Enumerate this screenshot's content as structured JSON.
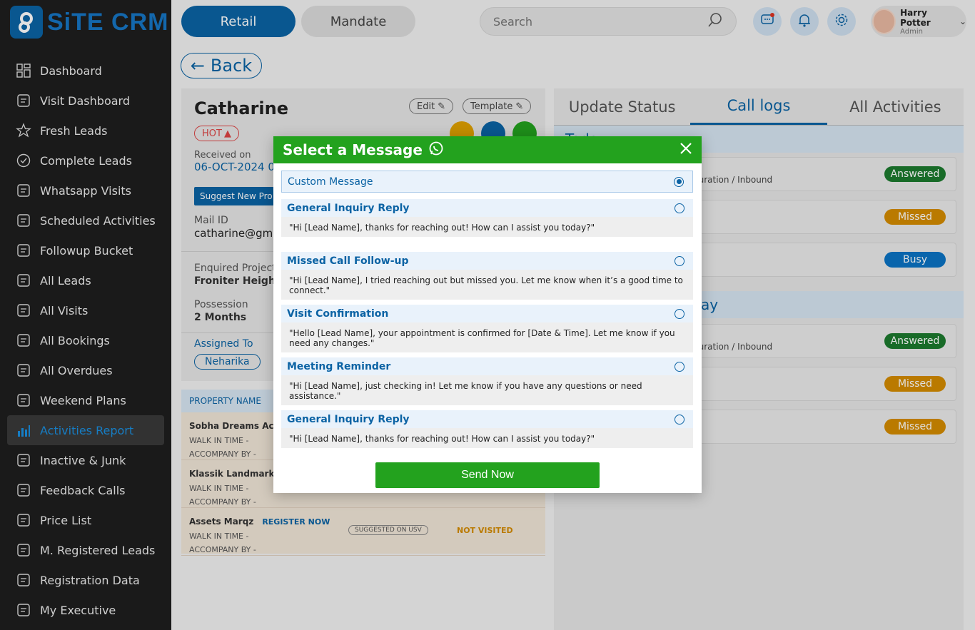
{
  "app": {
    "logo_text": "SiTE CRM"
  },
  "sidebar": {
    "items": [
      {
        "label": "Dashboard",
        "icon": "dashboard-icon"
      },
      {
        "label": "Visit Dashboard",
        "icon": "location-pin-icon"
      },
      {
        "label": "Fresh Leads",
        "icon": "star-icon"
      },
      {
        "label": "Complete Leads",
        "icon": "check-circle-icon"
      },
      {
        "label": "Whatsapp Visits",
        "icon": "whatsapp-icon"
      },
      {
        "label": "Scheduled Activities",
        "icon": "calendar-clock-icon"
      },
      {
        "label": "Followup Bucket",
        "icon": "user-bucket-icon"
      },
      {
        "label": "All Leads",
        "icon": "users-icon"
      },
      {
        "label": "All Visits",
        "icon": "building-icon"
      },
      {
        "label": "All Bookings",
        "icon": "document-icon"
      },
      {
        "label": "All Overdues",
        "icon": "overdue-clock-icon"
      },
      {
        "label": "Weekend Plans",
        "icon": "checklist-icon"
      },
      {
        "label": "Activities Report",
        "icon": "bar-chart-icon"
      },
      {
        "label": "Inactive & Junk",
        "icon": "moon-icon"
      },
      {
        "label": "Feedback Calls",
        "icon": "phone-feedback-icon"
      },
      {
        "label": "Price List",
        "icon": "price-list-icon"
      },
      {
        "label": "M. Registered Leads",
        "icon": "registered-icon"
      },
      {
        "label": "Registration Data",
        "icon": "edit-document-icon"
      },
      {
        "label": "My Executive",
        "icon": "team-icon"
      }
    ],
    "active_index": 12
  },
  "topbar": {
    "retail_label": "Retail",
    "mandate_label": "Mandate",
    "search_placeholder": "Search",
    "user_name": "Harry Potter",
    "user_role": "Admin"
  },
  "back_label": "Back",
  "lead": {
    "name": "Catharine",
    "hot_label": "HOT",
    "edit_label": "Edit",
    "template_label": "Template",
    "received_label": "Received on",
    "received_value": "06-OCT-2024 0",
    "suggest_label": "Suggest New Pro",
    "mail_label": "Mail ID",
    "mail_value": "catharine@gm",
    "project_label": "Enquired Project",
    "project_value": "Froniter Heights",
    "possession_label": "Possession",
    "possession_value": "2 Months",
    "assigned_label": "Assigned To",
    "assigned_value": "Neharika"
  },
  "properties": {
    "header": "PROPERTY NAME",
    "rows": [
      {
        "name": "Sobha Dreams Acre",
        "register": "",
        "walk": "WALK IN TIME -",
        "accompany": "ACCOMPANY BY -",
        "suggested": "",
        "status": ""
      },
      {
        "name": "Klassik Landmark",
        "register": "R",
        "walk": "WALK IN TIME -",
        "accompany": "ACCOMPANY BY -",
        "suggested": "",
        "status": ""
      },
      {
        "name": "Assets Marqz",
        "register": "REGISTER NOW",
        "walk": "WALK IN TIME -",
        "accompany": "ACCOMPANY BY -",
        "suggested": "SUGGESTED ON USV",
        "status": "NOT VISITED"
      }
    ]
  },
  "right_panel": {
    "tabs": [
      "Update Status",
      "Call logs",
      "All Activities"
    ],
    "active_tab": 1,
    "today_label": "Today",
    "yesterday_label": "ay",
    "today_logs": [
      {
        "sub": "duration / Inbound",
        "status": "Answered"
      },
      {
        "sub": "",
        "status": "Missed"
      },
      {
        "sub": "",
        "status": "Busy"
      }
    ],
    "earlier_logs": [
      {
        "sub": "duration / Inbound",
        "status": "Answered"
      },
      {
        "sub": "",
        "status": "Missed"
      },
      {
        "sub": "",
        "status": "Missed"
      }
    ]
  },
  "modal": {
    "title": "Select a Message",
    "custom_label": "Custom Message",
    "options": [
      {
        "title": "General Inquiry Reply",
        "body": "\"Hi [Lead Name], thanks for reaching out! How can I assist you today?\""
      },
      {
        "title": "Missed Call Follow-up",
        "body": "\"Hi [Lead Name], I tried reaching out but missed you. Let me know when it’s a good time to connect.\""
      },
      {
        "title": "Visit Confirmation",
        "body": "\"Hello [Lead Name], your appointment is confirmed for [Date & Time]. Let me know if you need any changes.\""
      },
      {
        "title": "Meeting Reminder",
        "body": "\"Hi [Lead Name], just checking in! Let me know if you have any questions or need assistance.\""
      },
      {
        "title": "General Inquiry Reply",
        "body": "\"Hi [Lead Name], thanks for reaching out! How can I assist you today?\""
      }
    ],
    "send_label": "Send Now"
  },
  "colors": {
    "brand": "#0b63a4",
    "whatsapp_green": "#23a21e",
    "missed": "#d48b00",
    "answered": "#1c7a2e"
  }
}
